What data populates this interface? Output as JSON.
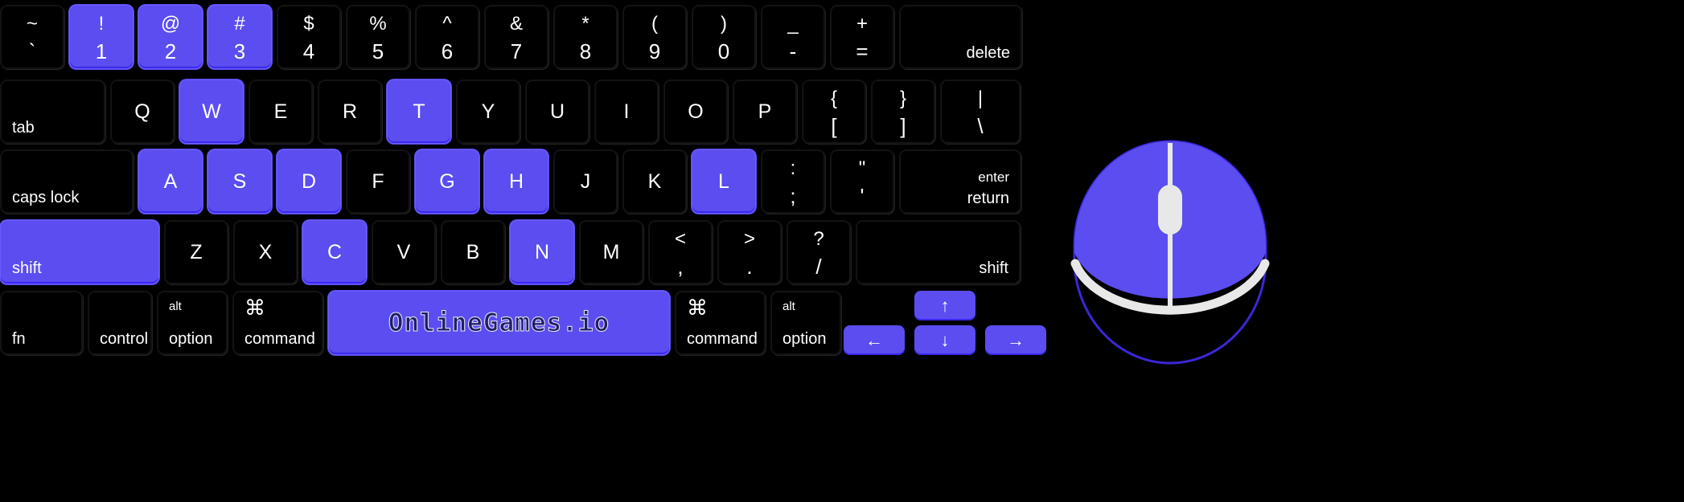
{
  "theme": {
    "background": "#000000",
    "key_face": "#000000",
    "key_text": "#ffffff",
    "highlight": "#5b4df0",
    "highlight_edge": "#3b27f0",
    "mouse_accent": "#5b4df0",
    "mouse_divider": "#e8e8e8"
  },
  "branding": {
    "spacebar_logo": "OnlineGames.io"
  },
  "keyboard": {
    "row_number": [
      {
        "name": "tilde",
        "top": "~",
        "bottom": "`",
        "active": false
      },
      {
        "name": "one",
        "top": "!",
        "bottom": "1",
        "active": true
      },
      {
        "name": "two",
        "top": "@",
        "bottom": "2",
        "active": true
      },
      {
        "name": "three",
        "top": "#",
        "bottom": "3",
        "active": true
      },
      {
        "name": "four",
        "top": "$",
        "bottom": "4",
        "active": false
      },
      {
        "name": "five",
        "top": "%",
        "bottom": "5",
        "active": false
      },
      {
        "name": "six",
        "top": "^",
        "bottom": "6",
        "active": false
      },
      {
        "name": "seven",
        "top": "&",
        "bottom": "7",
        "active": false
      },
      {
        "name": "eight",
        "top": "*",
        "bottom": "8",
        "active": false
      },
      {
        "name": "nine",
        "top": "(",
        "bottom": "9",
        "active": false
      },
      {
        "name": "zero",
        "top": ")",
        "bottom": "0",
        "active": false
      },
      {
        "name": "minus",
        "top": "_",
        "bottom": "-",
        "active": false
      },
      {
        "name": "equal",
        "top": "+",
        "bottom": "=",
        "active": false
      },
      {
        "name": "delete",
        "label": "delete",
        "active": false
      }
    ],
    "row_tab": [
      {
        "name": "tab",
        "label": "tab",
        "active": false
      },
      {
        "name": "q",
        "label": "Q",
        "active": false
      },
      {
        "name": "w",
        "label": "W",
        "active": true
      },
      {
        "name": "e",
        "label": "E",
        "active": false
      },
      {
        "name": "r",
        "label": "R",
        "active": false
      },
      {
        "name": "t",
        "label": "T",
        "active": true
      },
      {
        "name": "y",
        "label": "Y",
        "active": false
      },
      {
        "name": "u",
        "label": "U",
        "active": false
      },
      {
        "name": "i",
        "label": "I",
        "active": false
      },
      {
        "name": "o",
        "label": "O",
        "active": false
      },
      {
        "name": "p",
        "label": "P",
        "active": false
      },
      {
        "name": "bracket-left",
        "top": "{",
        "bottom": "[",
        "active": false
      },
      {
        "name": "bracket-right",
        "top": "}",
        "bottom": "]",
        "active": false
      },
      {
        "name": "backslash",
        "top": "|",
        "bottom": "\\",
        "active": false
      }
    ],
    "row_home": [
      {
        "name": "caps-lock",
        "label": "caps lock",
        "active": false
      },
      {
        "name": "a",
        "label": "A",
        "active": true
      },
      {
        "name": "s",
        "label": "S",
        "active": true
      },
      {
        "name": "d",
        "label": "D",
        "active": true
      },
      {
        "name": "f",
        "label": "F",
        "active": false
      },
      {
        "name": "g",
        "label": "G",
        "active": true
      },
      {
        "name": "h",
        "label": "H",
        "active": true
      },
      {
        "name": "j",
        "label": "J",
        "active": false
      },
      {
        "name": "k",
        "label": "K",
        "active": false
      },
      {
        "name": "l",
        "label": "L",
        "active": true
      },
      {
        "name": "semicolon",
        "top": ":",
        "bottom": ";",
        "active": false
      },
      {
        "name": "quote",
        "top": "\"",
        "bottom": "'",
        "active": false
      },
      {
        "name": "enter-return",
        "line1": "enter",
        "line2": "return",
        "active": false
      }
    ],
    "row_shift": [
      {
        "name": "shift-left",
        "label": "shift",
        "active": true
      },
      {
        "name": "z",
        "label": "Z",
        "active": false
      },
      {
        "name": "x",
        "label": "X",
        "active": false
      },
      {
        "name": "c",
        "label": "C",
        "active": true
      },
      {
        "name": "v",
        "label": "V",
        "active": false
      },
      {
        "name": "b",
        "label": "B",
        "active": false
      },
      {
        "name": "n",
        "label": "N",
        "active": true
      },
      {
        "name": "m",
        "label": "M",
        "active": false
      },
      {
        "name": "comma",
        "top": "<",
        "bottom": ",",
        "active": false
      },
      {
        "name": "period",
        "top": ">",
        "bottom": ".",
        "active": false
      },
      {
        "name": "slash",
        "top": "?",
        "bottom": "/",
        "active": false
      },
      {
        "name": "shift-right",
        "label": "shift",
        "active": false
      }
    ],
    "row_bottom": [
      {
        "name": "fn",
        "label": "fn",
        "active": false
      },
      {
        "name": "control",
        "label": "control",
        "active": false
      },
      {
        "name": "option-left",
        "sup": "alt",
        "label": "option",
        "active": false
      },
      {
        "name": "command-left",
        "sup": "⌘",
        "label": "command",
        "active": false
      },
      {
        "name": "spacebar",
        "label": "OnlineGames.io",
        "active": true
      },
      {
        "name": "command-right",
        "sup": "⌘",
        "label": "command",
        "active": false
      },
      {
        "name": "option-right",
        "sup": "alt",
        "label": "option",
        "active": false
      }
    ],
    "arrows": [
      {
        "name": "arrow-up",
        "glyph": "↑",
        "active": true
      },
      {
        "name": "arrow-left",
        "glyph": "←",
        "active": true
      },
      {
        "name": "arrow-down",
        "glyph": "↓",
        "active": true
      },
      {
        "name": "arrow-right",
        "glyph": "→",
        "active": true
      }
    ]
  },
  "mouse": {
    "name": "computer-mouse",
    "left_button_active": true,
    "right_button_active": true,
    "scroll_wheel_active": true
  }
}
